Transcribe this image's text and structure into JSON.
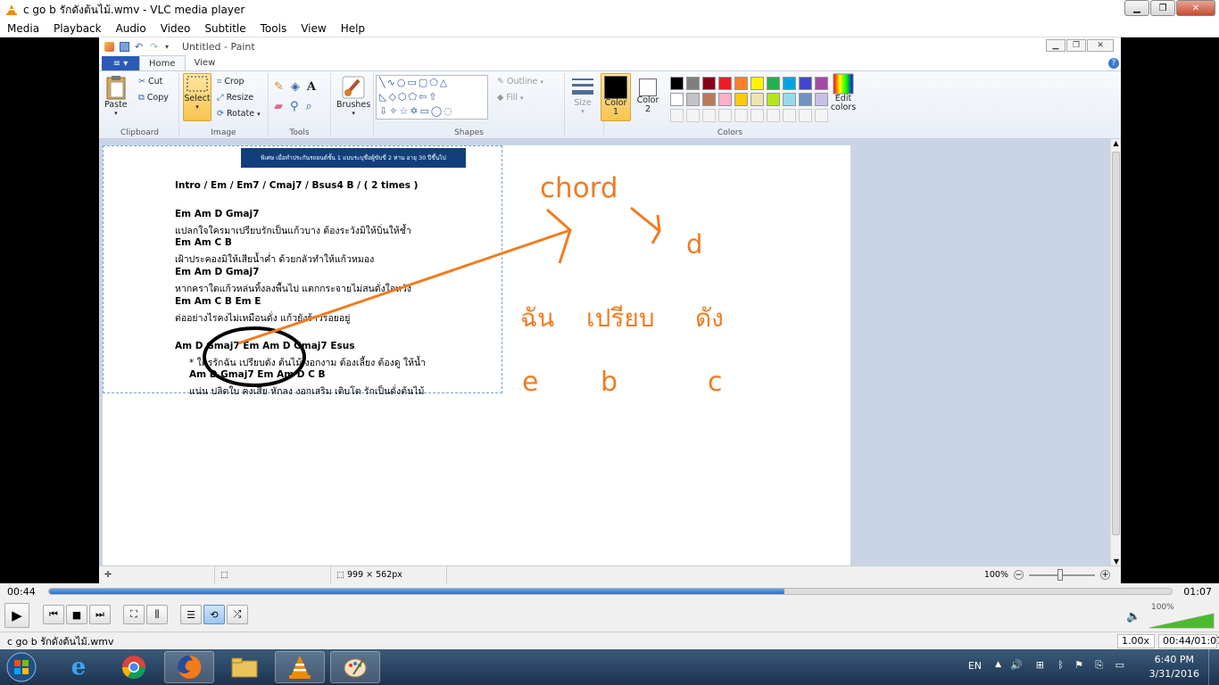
{
  "vlc": {
    "title": "c go b รักดังต้นไม้.wmv - VLC media player",
    "menu": [
      "Media",
      "Playback",
      "Audio",
      "Video",
      "Subtitle",
      "Tools",
      "View",
      "Help"
    ],
    "elapsed": "00:44",
    "total": "01:07",
    "progress": 0.655,
    "volume_label": "100%",
    "volume": 1.0,
    "status_file": "c go b รักดังต้นไม้.wmv",
    "speed": "1.00x",
    "time_readout": "00:44/01:07",
    "accent": "#2f6fc4"
  },
  "paint": {
    "title": "Untitled - Paint",
    "file_tab": "≡ ▾",
    "tabs": [
      "Home",
      "View"
    ],
    "clipboard": {
      "paste": "Paste",
      "cut": "Cut",
      "copy": "Copy",
      "label": "Clipboard"
    },
    "image": {
      "select": "Select",
      "crop": "Crop",
      "resize": "Resize",
      "rotate": "Rotate",
      "label": "Image"
    },
    "tools": {
      "label": "Tools"
    },
    "brushes": "Brushes",
    "shapes": {
      "label": "Shapes",
      "outline": "Outline",
      "fill": "Fill"
    },
    "size": "Size",
    "color1": "Color 1",
    "color2": "Color 2",
    "colors_label": "Colors",
    "edit_colors": "Edit colors",
    "palette_row1": [
      "#000000",
      "#7f7f7f",
      "#880015",
      "#ed1c24",
      "#ff7f27",
      "#fff200",
      "#22b14c",
      "#00a2e8",
      "#3f48cc",
      "#a349a4"
    ],
    "palette_row2": [
      "#ffffff",
      "#c3c3c3",
      "#b97a57",
      "#ffaec9",
      "#ffc90e",
      "#efe4b0",
      "#b5e61d",
      "#99d9ea",
      "#7092be",
      "#c8bfe7"
    ],
    "status_size": "999 × 562px",
    "zoom": "100%"
  },
  "sheet": {
    "banner": "พิเศษ เมื่อทำประกันรถยนต์ชั้น 1 แบบระบุชื่อผู้ขับขี่ 2 ท่าน อายุ 30 ปีขึ้นไป",
    "intro": "Intro  / Em / Em7 / Cmaj7 / Bsus4 B / ( 2 times )",
    "lines": [
      {
        "chords": "Em                Am                    D                  Gmaj7",
        "lyric": " แปลกใจใครมาเปรียบรักเป็นแก้วบาง  ต้องระวังมิให้บิ่นให้ช้ำ"
      },
      {
        "chords": "Em                        Am      C                 B",
        "lyric": " เฝ้าประคองมิให้เสียน้ำค่ำ   ด้วยกลัวทำให้แก้วหมอง"
      },
      {
        "chords": "Em                        Am                  D                        Gmaj7",
        "lyric": " หากคราใดแก้วหล่นทิ้งลงพื้นไป    แตกกระจายไม่สนดั่งใจหวัง"
      },
      {
        "chords": "Em                        Am      C         B       Em    E",
        "lyric": " ต่ออย่างไรคงไม่เหมือนดั่ง  แก้วยังร้าวรอยอยู่"
      }
    ],
    "chorus_chords": "       Am           D         Gmaj7  Em      Am       D     Gmaj7  Esus",
    "chorus_lyric": "*  ใครรักฉัน เปรียบดัง ต้นไม้ งอกงาม ต้องเลี้ยง ต้องดู ให้น้ำ",
    "chorus2_chords": "  Am      D       Gmaj7  Em       Am         D    C              B",
    "chorus2_lyric": " แน่น ปลิดใบ คงเสีย  หักลง    งอกเสริม เติบโต       รักเป็นดั่งต้นไม้",
    "anno_chord": "chord",
    "anno_d": "d",
    "anno_thai": [
      "ฉัน",
      "เปรียบ",
      "ดัง"
    ],
    "anno_letters": [
      "e",
      "b",
      "c"
    ],
    "anno_color": "#f07c22"
  },
  "taskbar": {
    "lang": "EN",
    "time": "6:40 PM",
    "date": "3/31/2016"
  }
}
